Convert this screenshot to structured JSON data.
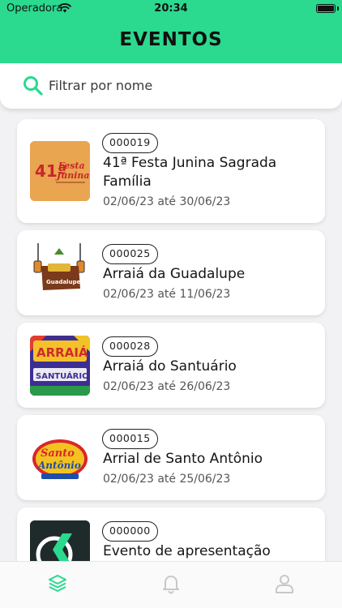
{
  "status_bar": {
    "carrier": "Operadora",
    "time": "20:34"
  },
  "header": {
    "title": "EVENTOS",
    "color": "#2bd98f"
  },
  "search": {
    "placeholder": "Filtrar por nome",
    "value": ""
  },
  "events": [
    {
      "code": "000019",
      "title": "41ª Festa Junina Sagrada Família",
      "dates": "02/06/23 até 30/06/23",
      "thumb": "festa-junina-logo"
    },
    {
      "code": "000025",
      "title": "Arraiá da Guadalupe",
      "dates": "02/06/23 até 11/06/23",
      "thumb": "guadalupe-sign-logo"
    },
    {
      "code": "000028",
      "title": "Arraiá do Santuário",
      "dates": "02/06/23 até 26/06/23",
      "thumb": "santuario-logo"
    },
    {
      "code": "000015",
      "title": "Arrial de Santo Antônio",
      "dates": "02/06/23 até 25/06/23",
      "thumb": "santo-antonio-logo"
    },
    {
      "code": "000000",
      "title": "Evento de apresentação",
      "dates": "",
      "thumb": "k-logo"
    }
  ],
  "thumb_texts": {
    "festa_num": "41ª",
    "festa_line1": "Festa",
    "festa_line2": "Junina",
    "guadalupe": "Guadalupe",
    "santuario_top": "ARRAIÁ",
    "santuario_bottom": "SANTUÁRIO",
    "santo_top": "Santo",
    "santo_bottom": "Antônio"
  },
  "tabs": [
    {
      "name": "events",
      "icon": "layers-icon",
      "active": true
    },
    {
      "name": "notifications",
      "icon": "bell-icon",
      "active": false
    },
    {
      "name": "profile",
      "icon": "user-icon",
      "active": false
    }
  ],
  "colors": {
    "accent": "#2bd98f",
    "tab_inactive": "#c8c8cc"
  }
}
